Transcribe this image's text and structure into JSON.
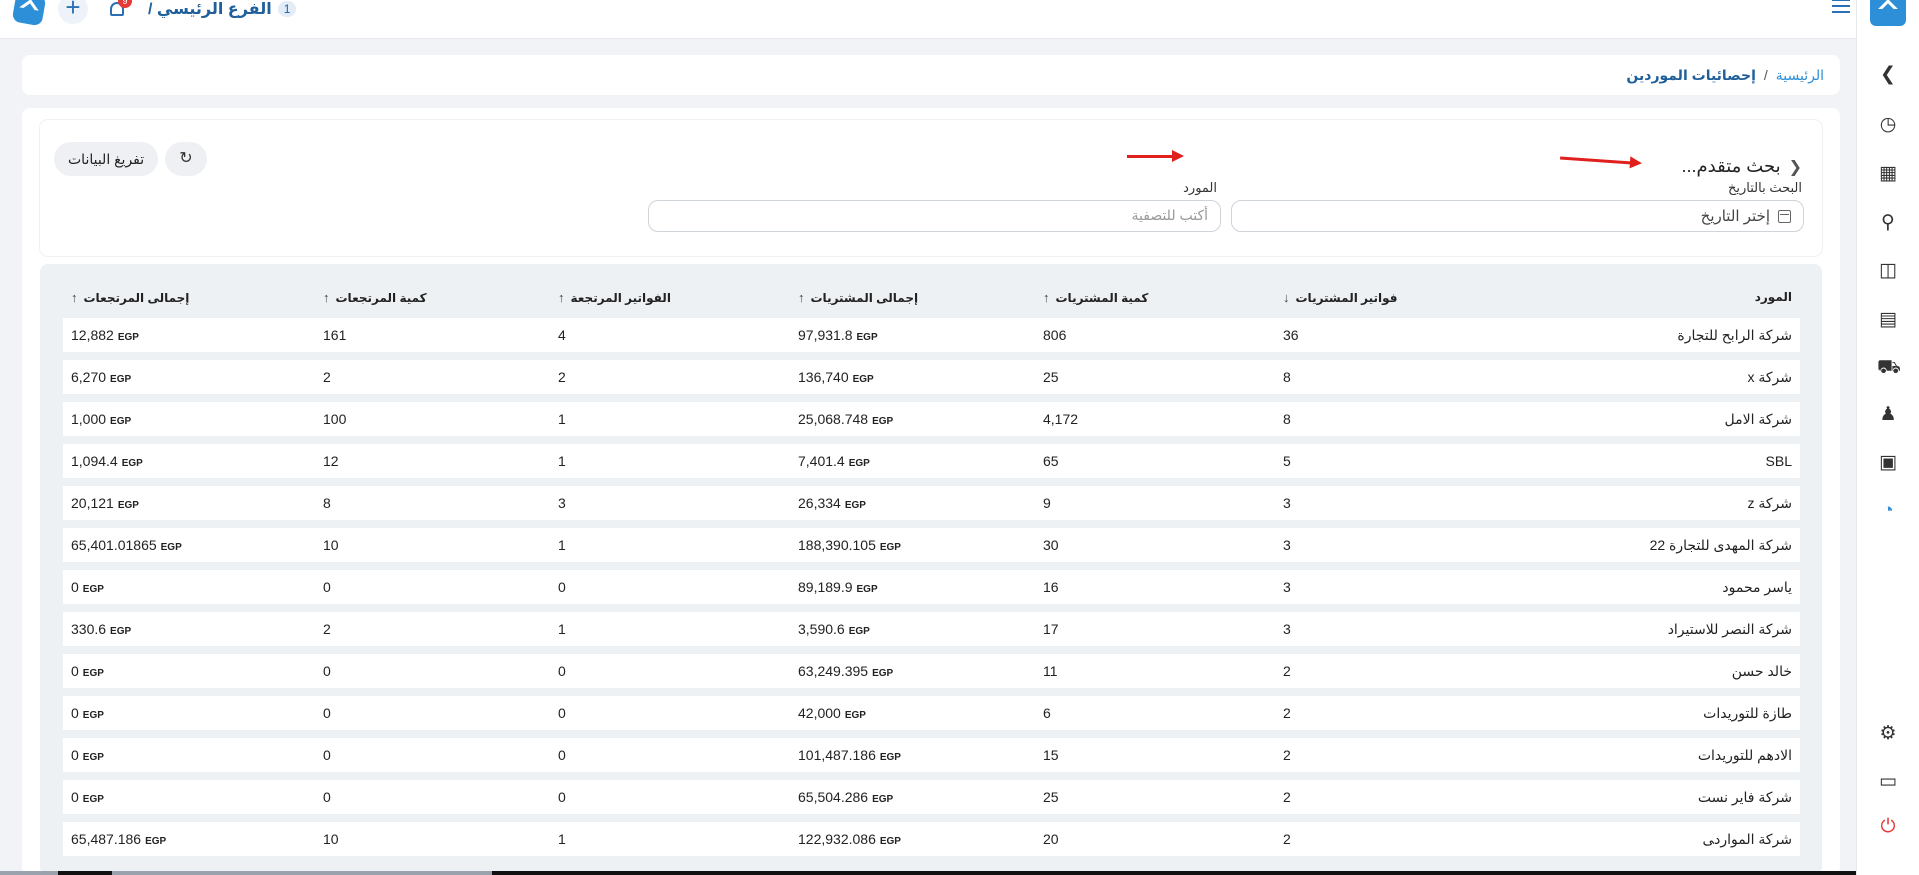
{
  "topbar": {
    "branch_number": "1",
    "branch_name": "الفرع الرئيسي /",
    "notification_count": "9"
  },
  "breadcrumb": {
    "home": "الرئيسية",
    "separator": "/",
    "current": "إحصائيات الموردين"
  },
  "search": {
    "title": "بحث متقدم...",
    "date_label": "البحث بالتاريخ",
    "date_placeholder": "إختر التاريخ",
    "supplier_label": "المورد",
    "supplier_placeholder": "أكتب للتصفية",
    "clear_button": "تفريغ البيانات"
  },
  "table": {
    "currency": "EGP",
    "headers": [
      "المورد",
      "فواتير المشتريات",
      "كمية المشتريات",
      "إجمالى المشتريات",
      "الفواتير المرتجعة",
      "كمية المرتجعات",
      "إجمالى المرتجعات"
    ],
    "rows": [
      [
        "شركة الرابح للتجارة",
        "36",
        "806",
        "97,931.8",
        "4",
        "161",
        "12,882"
      ],
      [
        "شركة x",
        "8",
        "25",
        "136,740",
        "2",
        "2",
        "6,270"
      ],
      [
        "شركة الامل",
        "8",
        "4,172",
        "25,068.748",
        "1",
        "100",
        "1,000"
      ],
      [
        "SBL",
        "5",
        "65",
        "7,401.4",
        "1",
        "12",
        "1,094.4"
      ],
      [
        "شركة z",
        "3",
        "9",
        "26,334",
        "3",
        "8",
        "20,121"
      ],
      [
        "شركة المهدى للتجارة 22",
        "3",
        "30",
        "188,390.105",
        "1",
        "10",
        "65,401.01865"
      ],
      [
        "ياسر محمود",
        "3",
        "16",
        "89,189.9",
        "0",
        "0",
        "0"
      ],
      [
        "شركة النصر للاستيراد",
        "3",
        "17",
        "3,590.6",
        "1",
        "2",
        "330.6"
      ],
      [
        "خالد حسن",
        "2",
        "11",
        "63,249.395",
        "0",
        "0",
        "0"
      ],
      [
        "طازة للتوريدات",
        "2",
        "6",
        "42,000",
        "0",
        "0",
        "0"
      ],
      [
        "الادهم للتوريدات",
        "2",
        "15",
        "101,487.186",
        "0",
        "0",
        "0"
      ],
      [
        "شركة فاير نست",
        "2",
        "25",
        "65,504.286",
        "0",
        "0",
        "0"
      ],
      [
        "شركة الموارد‍ى",
        "2",
        "20",
        "122,932.086",
        "1",
        "10",
        "65,487.186"
      ]
    ]
  },
  "colors": {
    "accent": "#2d8fd8",
    "brand_dark": "#1f5f9a",
    "annotation_arrow": "#e0201c",
    "badge": "#e53935"
  }
}
